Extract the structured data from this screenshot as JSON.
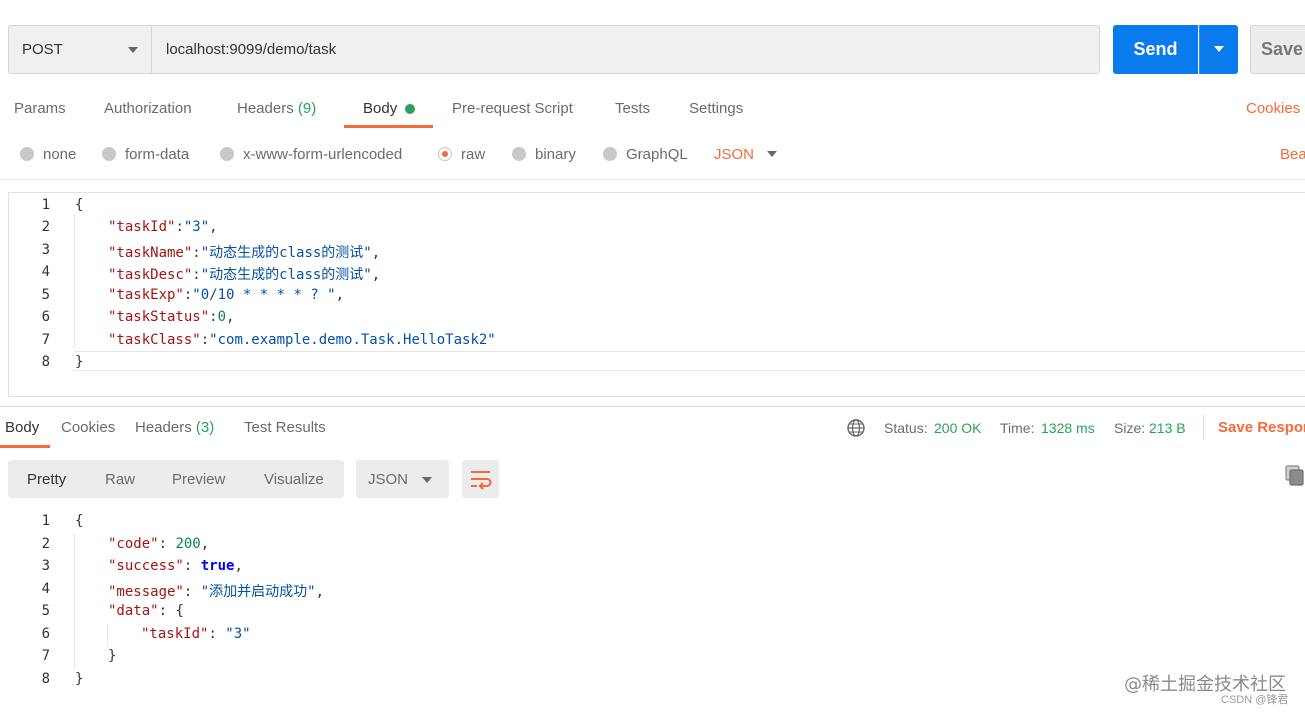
{
  "request": {
    "method": "POST",
    "url": "localhost:9099/demo/task",
    "send_label": "Send",
    "save_label": "Save"
  },
  "request_tabs": {
    "params": "Params",
    "authorization": "Authorization",
    "headers": "Headers",
    "headers_count": "(9)",
    "body": "Body",
    "prerequest": "Pre-request Script",
    "tests": "Tests",
    "settings": "Settings",
    "cookies": "Cookies"
  },
  "body_types": {
    "none": "none",
    "form_data": "form-data",
    "urlencoded": "x-www-form-urlencoded",
    "raw": "raw",
    "binary": "binary",
    "graphql": "GraphQL",
    "selected": "raw",
    "format": "JSON",
    "beautify": "Bea"
  },
  "request_body": {
    "line_numbers": [
      "1",
      "2",
      "3",
      "4",
      "5",
      "6",
      "7",
      "8"
    ],
    "lines": [
      [
        "{"
      ],
      [
        "\"taskId\"",
        ":",
        "\"3\"",
        ","
      ],
      [
        "\"taskName\"",
        ":",
        "\"动态生成的class的测试\"",
        ","
      ],
      [
        "\"taskDesc\"",
        ":",
        "\"动态生成的class的测试\"",
        ","
      ],
      [
        "\"taskExp\"",
        ":",
        "\"0/10 * * * * ? \"",
        ","
      ],
      [
        "\"taskStatus\"",
        ":",
        "0",
        ","
      ],
      [
        "\"taskClass\"",
        ":",
        "\"com.example.demo.Task.HelloTask2\""
      ],
      [
        "}"
      ]
    ]
  },
  "response_tabs": {
    "body": "Body",
    "cookies": "Cookies",
    "headers": "Headers",
    "headers_count": "(3)",
    "test_results": "Test Results"
  },
  "response_status": {
    "status_label": "Status:",
    "status_value": "200 OK",
    "time_label": "Time:",
    "time_value": "1328 ms",
    "size_label": "Size:",
    "size_value": "213 B",
    "save_response": "Save Respor"
  },
  "view_tabs": {
    "pretty": "Pretty",
    "raw": "Raw",
    "preview": "Preview",
    "visualize": "Visualize",
    "format": "JSON"
  },
  "response_body": {
    "line_numbers": [
      "1",
      "2",
      "3",
      "4",
      "5",
      "6",
      "7",
      "8"
    ],
    "lines": [
      [
        "{"
      ],
      [
        "\"code\"",
        ": ",
        "200",
        ","
      ],
      [
        "\"success\"",
        ": ",
        "true",
        ","
      ],
      [
        "\"message\"",
        ": ",
        "\"添加并启动成功\"",
        ","
      ],
      [
        "\"data\"",
        ": ",
        "{"
      ],
      [
        "\"taskId\"",
        ": ",
        "\"3\""
      ],
      [
        "}"
      ],
      [
        "}"
      ]
    ]
  },
  "watermark": {
    "main": "@稀土掘金技术社区",
    "sub": "CSDN @锋君"
  },
  "colors": {
    "send": "#097bed",
    "accent": "#f26b3a",
    "success": "#27a35a"
  }
}
